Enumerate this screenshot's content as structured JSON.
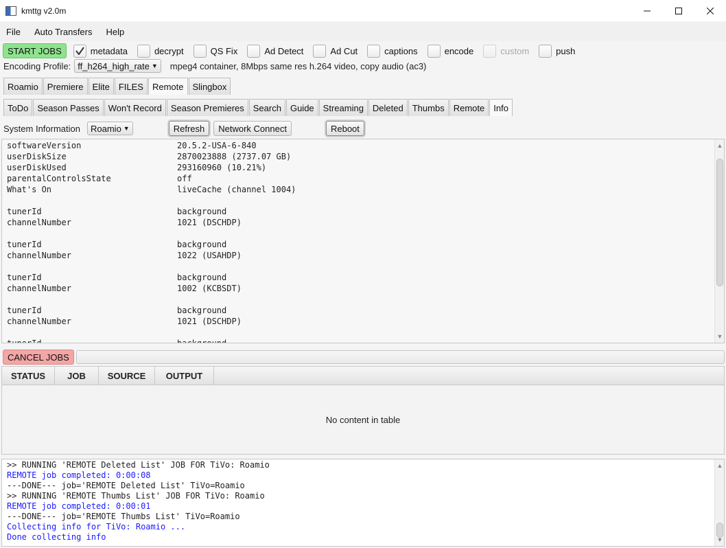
{
  "window": {
    "title": "kmttg v2.0m"
  },
  "menu": [
    "File",
    "Auto Transfers",
    "Help"
  ],
  "toolbar": {
    "start_label": "START JOBS",
    "options": [
      {
        "label": "metadata",
        "checked": true,
        "disabled": false
      },
      {
        "label": "decrypt",
        "checked": false,
        "disabled": false
      },
      {
        "label": "QS Fix",
        "checked": false,
        "disabled": false
      },
      {
        "label": "Ad Detect",
        "checked": false,
        "disabled": false
      },
      {
        "label": "Ad Cut",
        "checked": false,
        "disabled": false
      },
      {
        "label": "captions",
        "checked": false,
        "disabled": false
      },
      {
        "label": "encode",
        "checked": false,
        "disabled": false
      },
      {
        "label": "custom",
        "checked": false,
        "disabled": true
      },
      {
        "label": "push",
        "checked": false,
        "disabled": false
      }
    ]
  },
  "encoding": {
    "label": "Encoding Profile:",
    "profile": "ff_h264_high_rate",
    "description": "mpeg4 container, 8Mbps same res h.264 video, copy audio (ac3)"
  },
  "device_tabs": [
    {
      "label": "Roamio",
      "selected": false
    },
    {
      "label": "Premiere",
      "selected": false
    },
    {
      "label": "Elite",
      "selected": false
    },
    {
      "label": "FILES",
      "selected": false
    },
    {
      "label": "Remote",
      "selected": true
    },
    {
      "label": "Slingbox",
      "selected": false
    }
  ],
  "remote_tabs": [
    {
      "label": "ToDo",
      "selected": false
    },
    {
      "label": "Season Passes",
      "selected": false
    },
    {
      "label": "Won't Record",
      "selected": false
    },
    {
      "label": "Season Premieres",
      "selected": false
    },
    {
      "label": "Search",
      "selected": false
    },
    {
      "label": "Guide",
      "selected": false
    },
    {
      "label": "Streaming",
      "selected": false
    },
    {
      "label": "Deleted",
      "selected": false
    },
    {
      "label": "Thumbs",
      "selected": false
    },
    {
      "label": "Remote",
      "selected": false
    },
    {
      "label": "Info",
      "selected": true
    }
  ],
  "sysinfo": {
    "label": "System Information",
    "tivo": "Roamio",
    "refresh": "Refresh",
    "network_connect": "Network Connect",
    "reboot": "Reboot"
  },
  "info_lines": [
    [
      "softwareVersion",
      "20.5.2-USA-6-840"
    ],
    [
      "userDiskSize",
      "2870023888 (2737.07 GB)"
    ],
    [
      "userDiskUsed",
      "293160960 (10.21%)"
    ],
    [
      "parentalControlsState",
      "off"
    ],
    [
      "What's On",
      "liveCache (channel 1004)"
    ],
    [
      "",
      ""
    ],
    [
      "tunerId",
      "background"
    ],
    [
      "channelNumber",
      "1021 (DSCHDP)"
    ],
    [
      "",
      ""
    ],
    [
      "tunerId",
      "background"
    ],
    [
      "channelNumber",
      "1022 (USAHDP)"
    ],
    [
      "",
      ""
    ],
    [
      "tunerId",
      "background"
    ],
    [
      "channelNumber",
      "1002 (KCBSDT)"
    ],
    [
      "",
      ""
    ],
    [
      "tunerId",
      "background"
    ],
    [
      "channelNumber",
      "1021 (DSCHDP)"
    ],
    [
      "",
      ""
    ],
    [
      "tunerId",
      "background"
    ]
  ],
  "jobs": {
    "cancel_label": "CANCEL JOBS",
    "columns": [
      "STATUS",
      "JOB",
      "SOURCE",
      "OUTPUT"
    ],
    "empty_text": "No content in table"
  },
  "colors": {
    "log_black": "#222222",
    "log_blue": "#1a1aff"
  },
  "log": [
    {
      "text": ">> RUNNING 'REMOTE Deleted List' JOB FOR TiVo: Roamio",
      "color": "black"
    },
    {
      "text": "REMOTE job completed: 0:00:08",
      "color": "blue"
    },
    {
      "text": "---DONE--- job='REMOTE Deleted List' TiVo=Roamio",
      "color": "black"
    },
    {
      "text": ">> RUNNING 'REMOTE Thumbs List' JOB FOR TiVo: Roamio",
      "color": "black"
    },
    {
      "text": "REMOTE job completed: 0:00:01",
      "color": "blue"
    },
    {
      "text": "---DONE--- job='REMOTE Thumbs List' TiVo=Roamio",
      "color": "black"
    },
    {
      "text": "Collecting info for TiVo: Roamio ...",
      "color": "blue"
    },
    {
      "text": "Done collecting info",
      "color": "blue"
    }
  ]
}
